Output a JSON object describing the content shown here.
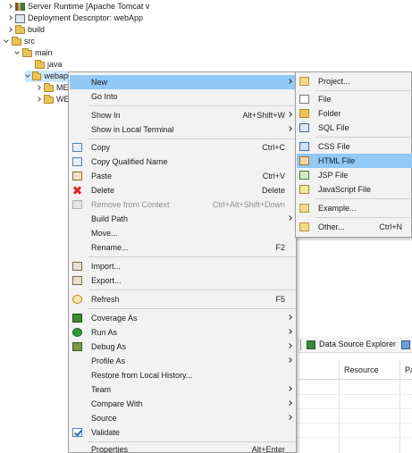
{
  "tree": {
    "items": [
      {
        "label": "Server Runtime [Apache Tomcat v",
        "expander": "right",
        "icon": "server-runtime-icon"
      },
      {
        "label": "Deployment Descriptor: webApp",
        "expander": "right",
        "icon": "deployment-descriptor-icon"
      },
      {
        "label": "build",
        "expander": "right",
        "icon": "folder-icon"
      },
      {
        "label": "src",
        "expander": "down",
        "icon": "folder-icon"
      },
      {
        "label": "main",
        "expander": "down",
        "icon": "folder-icon"
      },
      {
        "label": "java",
        "expander": "right",
        "icon": "folder-icon"
      },
      {
        "label": "webap",
        "expander": "down",
        "icon": "folder-icon",
        "selected": true
      },
      {
        "label": "ME",
        "expander": "right",
        "icon": "folder-icon"
      },
      {
        "label": "WE",
        "expander": "right",
        "icon": "folder-icon"
      }
    ]
  },
  "context_menu": {
    "items": [
      {
        "label": "New",
        "shortcut": "",
        "submenu": true,
        "icon": "",
        "highlighted": true
      },
      {
        "label": "Go Into",
        "shortcut": "",
        "submenu": false,
        "icon": ""
      },
      {
        "label": "Show In",
        "shortcut": "Alt+Shift+W",
        "submenu": true,
        "icon": ""
      },
      {
        "label": "Show in Local Terminal",
        "shortcut": "",
        "submenu": true,
        "icon": ""
      },
      {
        "label": "Copy",
        "shortcut": "Ctrl+C",
        "submenu": false,
        "icon": "copy-icon"
      },
      {
        "label": "Copy Qualified Name",
        "shortcut": "",
        "submenu": false,
        "icon": "copy-qualified-name-icon"
      },
      {
        "label": "Paste",
        "shortcut": "Ctrl+V",
        "submenu": false,
        "icon": "paste-icon"
      },
      {
        "label": "Delete",
        "shortcut": "Delete",
        "submenu": false,
        "icon": "delete-icon"
      },
      {
        "label": "Remove from Context",
        "shortcut": "Ctrl+Alt+Shift+Down",
        "submenu": false,
        "icon": "remove-context-icon",
        "disabled": true
      },
      {
        "label": "Build Path",
        "shortcut": "",
        "submenu": true,
        "icon": ""
      },
      {
        "label": "Move...",
        "shortcut": "",
        "submenu": false,
        "icon": ""
      },
      {
        "label": "Rename...",
        "shortcut": "F2",
        "submenu": false,
        "icon": ""
      },
      {
        "label": "Import...",
        "shortcut": "",
        "submenu": false,
        "icon": "import-icon"
      },
      {
        "label": "Export...",
        "shortcut": "",
        "submenu": false,
        "icon": "export-icon"
      },
      {
        "label": "Refresh",
        "shortcut": "F5",
        "submenu": false,
        "icon": "refresh-icon"
      },
      {
        "label": "Coverage As",
        "shortcut": "",
        "submenu": true,
        "icon": "coverage-icon"
      },
      {
        "label": "Run As",
        "shortcut": "",
        "submenu": true,
        "icon": "run-icon"
      },
      {
        "label": "Debug As",
        "shortcut": "",
        "submenu": true,
        "icon": "debug-icon"
      },
      {
        "label": "Profile As",
        "shortcut": "",
        "submenu": true,
        "icon": ""
      },
      {
        "label": "Restore from Local History...",
        "shortcut": "",
        "submenu": false,
        "icon": ""
      },
      {
        "label": "Team",
        "shortcut": "",
        "submenu": true,
        "icon": ""
      },
      {
        "label": "Compare With",
        "shortcut": "",
        "submenu": true,
        "icon": ""
      },
      {
        "label": "Source",
        "shortcut": "",
        "submenu": true,
        "icon": ""
      },
      {
        "label": "Validate",
        "shortcut": "",
        "submenu": false,
        "icon": "validate-icon"
      },
      {
        "label": "Properties",
        "shortcut": "Alt+Enter",
        "submenu": false,
        "icon": ""
      }
    ]
  },
  "submenu": {
    "items": [
      {
        "label": "Project...",
        "shortcut": "",
        "icon": "project-icon"
      },
      {
        "label": "File",
        "shortcut": "",
        "icon": "file-icon"
      },
      {
        "label": "Folder",
        "shortcut": "",
        "icon": "folder-icon"
      },
      {
        "label": "SQL File",
        "shortcut": "",
        "icon": "sql-file-icon"
      },
      {
        "label": "CSS File",
        "shortcut": "",
        "icon": "css-file-icon"
      },
      {
        "label": "HTML File",
        "shortcut": "",
        "icon": "html-file-icon",
        "highlighted": true
      },
      {
        "label": "JSP File",
        "shortcut": "",
        "icon": "jsp-file-icon"
      },
      {
        "label": "JavaScript File",
        "shortcut": "",
        "icon": "javascript-file-icon"
      },
      {
        "label": "Example...",
        "shortcut": "",
        "icon": "example-icon"
      },
      {
        "label": "Other...",
        "shortcut": "Ctrl+N",
        "icon": "other-icon"
      }
    ]
  },
  "background_view": {
    "toolbar_label": "Data Source Explorer",
    "columns": [
      "Resource",
      "Pa"
    ]
  },
  "colors": {
    "highlight": "#91c9f7",
    "menu_bg": "#f2f2f2",
    "selection": "#cde8ff"
  }
}
